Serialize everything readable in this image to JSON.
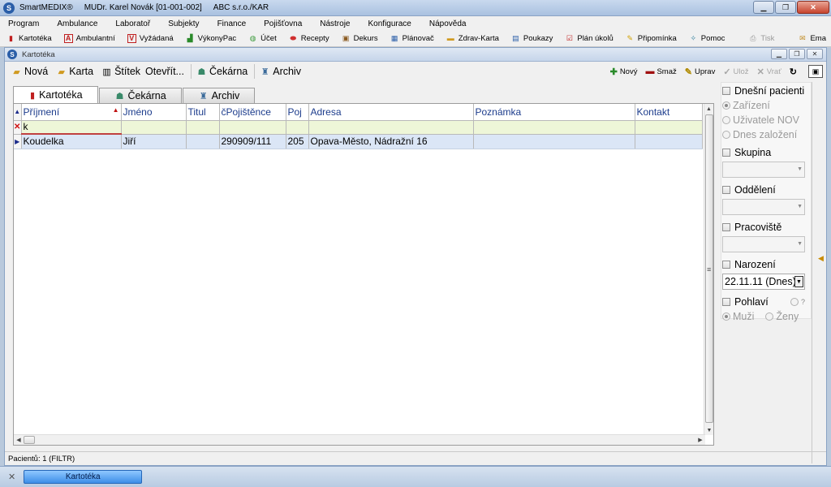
{
  "titlebar": {
    "app": "SmartMEDIX®",
    "doctor": "MUDr. Karel Novák [01-001-002]",
    "company": "ABC s.r.o./KAR"
  },
  "menu": [
    {
      "label": "Program"
    },
    {
      "label": "Ambulance"
    },
    {
      "label": "Laboratoř"
    },
    {
      "label": "Subjekty"
    },
    {
      "label": "Finance"
    },
    {
      "label": "Pojišťovna"
    },
    {
      "label": "Nástroje"
    },
    {
      "label": "Konfigurace"
    },
    {
      "label": "Nápověda"
    }
  ],
  "maintoolbar": [
    {
      "label": "Kartotéka",
      "icon": "kartoteka-icon"
    },
    {
      "label": "Ambulantní",
      "icon": "ambulantni-icon"
    },
    {
      "label": "Vyžádaná",
      "icon": "vyzadana-icon"
    },
    {
      "label": "VýkonyPac",
      "icon": "chart-icon"
    },
    {
      "label": "Účet",
      "icon": "ucet-icon"
    },
    {
      "label": "Recepty",
      "icon": "pill-icon"
    },
    {
      "label": "Dekurs",
      "icon": "dekurs-icon"
    },
    {
      "label": "Plánovač",
      "icon": "calendar-icon"
    },
    {
      "label": "Zdrav-Karta",
      "icon": "card-icon"
    },
    {
      "label": "Poukazy",
      "icon": "document-icon"
    },
    {
      "label": "Plán úkolů",
      "icon": "checklist-icon"
    },
    {
      "label": "Připomínka",
      "icon": "reminder-icon"
    },
    {
      "label": "Pomoc",
      "icon": "help-icon"
    },
    {
      "label": "Tisk",
      "icon": "print-icon"
    },
    {
      "label": "Ema",
      "icon": "email-icon"
    }
  ],
  "innerwindow": {
    "title": "Kartotéka"
  },
  "subtoolbar": {
    "nova": "Nová",
    "karta": "Karta",
    "stitek": "Štítek",
    "otevrit": "Otevřít...",
    "cekarna": "Čekárna",
    "archiv": "Archiv",
    "right": {
      "novy": "Nový",
      "smaz": "Smaž",
      "uprav": "Uprav",
      "uloz": "Ulož",
      "vrat": "Vrať"
    }
  },
  "tabs": [
    {
      "label": "Kartotéka"
    },
    {
      "label": "Čekárna"
    },
    {
      "label": "Archiv"
    }
  ],
  "grid": {
    "columns": [
      "Příjmení",
      "Jméno",
      "Titul",
      "čPojištěnce",
      "Poj",
      "Adresa",
      "Poznámka",
      "Kontakt"
    ],
    "filter": "k",
    "rows": [
      {
        "prijmeni": "Koudelka",
        "jmeno": "Jiří",
        "titul": "",
        "cpojistence": "290909/111",
        "poj": "205",
        "adresa": "Opava-Město, Nádražní 16",
        "poznamka": "",
        "kontakt": ""
      }
    ]
  },
  "rightpanel": {
    "dnesni_pacienti": "Dnešní pacienti",
    "zarizeni": "Zařízení",
    "uzivatele_nov": "Uživatele NOV",
    "dnes_zalozeni": "Dnes založení",
    "skupina": "Skupina",
    "oddeleni": "Oddělení",
    "pracoviste": "Pracoviště",
    "narozeni": "Narození",
    "narozeni_value": "22.11.11 (Dnes)",
    "pohlavi": "Pohlaví",
    "pohlavi_unknown": "?",
    "muzi": "Muži",
    "zeny": "Ženy"
  },
  "status": {
    "text": "Pacientů: 1  (FILTR)"
  },
  "taskbar": {
    "task": "Kartotéka"
  }
}
